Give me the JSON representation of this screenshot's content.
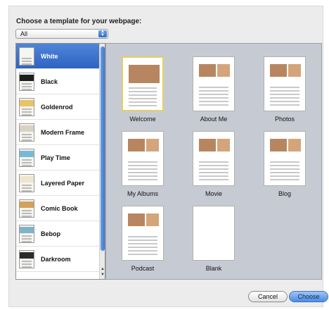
{
  "dialog": {
    "prompt": "Choose a template for your webpage:",
    "category_select": {
      "value": "All"
    }
  },
  "sidebar": {
    "items": [
      {
        "label": "White",
        "selected": true,
        "thumb_color": "#f7f5ef"
      },
      {
        "label": "Black",
        "selected": false,
        "thumb_color": "#1e1e1e"
      },
      {
        "label": "Goldenrod",
        "selected": false,
        "thumb_color": "#e5c46a"
      },
      {
        "label": "Modern Frame",
        "selected": false,
        "thumb_color": "#d8d2c4"
      },
      {
        "label": "Play Time",
        "selected": false,
        "thumb_color": "#79b9d6"
      },
      {
        "label": "Layered Paper",
        "selected": false,
        "thumb_color": "#efe6cf"
      },
      {
        "label": "Comic Book",
        "selected": false,
        "thumb_color": "#d2a15a"
      },
      {
        "label": "Bebop",
        "selected": false,
        "thumb_color": "#7fb4c8"
      },
      {
        "label": "Darkroom",
        "selected": false,
        "thumb_color": "#2c2c2c"
      }
    ]
  },
  "gallery": {
    "templates": [
      {
        "label": "Welcome",
        "selected": true
      },
      {
        "label": "About Me",
        "selected": false
      },
      {
        "label": "Photos",
        "selected": false
      },
      {
        "label": "My Albums",
        "selected": false
      },
      {
        "label": "Movie",
        "selected": false
      },
      {
        "label": "Blog",
        "selected": false
      },
      {
        "label": "Podcast",
        "selected": false
      },
      {
        "label": "Blank",
        "selected": false
      }
    ]
  },
  "buttons": {
    "cancel": "Cancel",
    "choose": "Choose"
  },
  "colors": {
    "selection": "#2e63c2",
    "gallery_bg": "#c6cbd3",
    "selected_outline": "#e3cf63"
  }
}
